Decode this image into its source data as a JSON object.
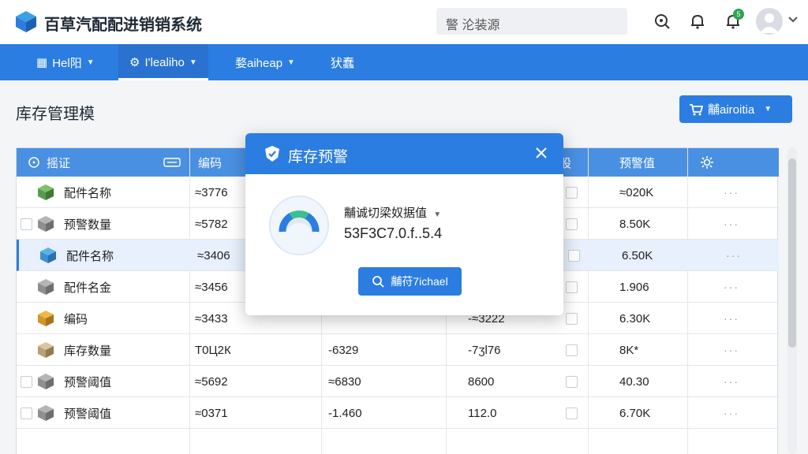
{
  "header": {
    "app_title": "百草汽配配进销销系统",
    "search_placeholder": "警 沦装源",
    "notification_count": "5"
  },
  "nav": [
    {
      "label": "Hel阳",
      "has_caret": true
    },
    {
      "label": "I'lealiho",
      "has_caret": true
    },
    {
      "label": "婺aiheap",
      "has_caret": true
    },
    {
      "label": "犾蠢",
      "has_caret": false
    }
  ],
  "page": {
    "title": "库存管理模",
    "primary_button": "黼airoitia"
  },
  "table": {
    "headers": [
      "摇证",
      "编码",
      "",
      "",
      "股",
      "预警值"
    ],
    "rows": [
      {
        "name": "配件名称",
        "c1": "≈3776",
        "c2": "",
        "c3": "",
        "c5": "≈020K",
        "selected": false,
        "has_check": false
      },
      {
        "name": "预警数量",
        "c1": "≈5782",
        "c2": "",
        "c3": "",
        "c5": "8.50K",
        "selected": false,
        "has_check": true
      },
      {
        "name": "配件名称",
        "c1": "≈3406",
        "c2": "",
        "c3": "",
        "c5": "6.50K",
        "selected": true,
        "has_check": false
      },
      {
        "name": "配件名金",
        "c1": "≈3456",
        "c2": "",
        "c3": "",
        "c5": "1.906",
        "selected": false,
        "has_check": false
      },
      {
        "name": "编码",
        "c1": "≈3433",
        "c2": "",
        "c3": "-≈3222",
        "c5": "6.30K",
        "selected": false,
        "has_check": false
      },
      {
        "name": "库存数量",
        "c1": "Т0Ц2К",
        "c2": "-6329",
        "c3": "-7ʒl76",
        "c5": "8K*",
        "selected": false,
        "has_check": false
      },
      {
        "name": "预警阈值",
        "c1": "≈5692",
        "c2": "≈6830",
        "c3": "8600",
        "c5": "40.30",
        "selected": false,
        "has_check": true
      },
      {
        "name": "预警阈值",
        "c1": "≈0371",
        "c2": "-1.460",
        "c3": "112.0",
        "c5": "6.70K",
        "selected": false,
        "has_check": true
      }
    ]
  },
  "modal": {
    "title": "库存预警",
    "label": "黼诚切梁奴据值",
    "value": "53F3C7.0.f..5.4",
    "button": "黼苻7ichael"
  },
  "colors": {
    "primary": "#2b7de1",
    "header_row": "#4a90e2",
    "selected_row": "#e7f0fc"
  }
}
